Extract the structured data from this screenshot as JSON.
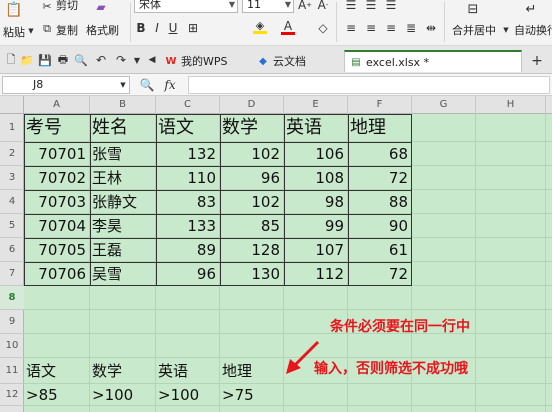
{
  "ribbon": {
    "cut_label": "剪切",
    "paste_label": "粘贴",
    "copy_label": "复制",
    "format_painter_label": "格式刷",
    "font_name": "宋体",
    "font_size": "11",
    "merge_center_label": "合并居中",
    "auto_wrap_label": "自动换行"
  },
  "tabs": [
    {
      "label": "我的WPS"
    },
    {
      "label": "云文档"
    },
    {
      "label": "excel.xlsx *"
    }
  ],
  "formula_bar": {
    "cell_ref": "J8",
    "fx_label": "fx",
    "content": ""
  },
  "columns": [
    "A",
    "B",
    "C",
    "D",
    "E",
    "F",
    "G",
    "H"
  ],
  "rows": [
    "1",
    "2",
    "3",
    "4",
    "5",
    "6",
    "7",
    "8",
    "9",
    "10",
    "11",
    "12"
  ],
  "selected_row": "8",
  "table": {
    "headers": [
      "考号",
      "姓名",
      "语文",
      "数学",
      "英语",
      "地理"
    ],
    "data": [
      [
        "70701",
        "张雪",
        "132",
        "102",
        "106",
        "68"
      ],
      [
        "70702",
        "王林",
        "110",
        "96",
        "108",
        "72"
      ],
      [
        "70703",
        "张静文",
        "83",
        "102",
        "98",
        "88"
      ],
      [
        "70704",
        "李昊",
        "133",
        "85",
        "99",
        "90"
      ],
      [
        "70705",
        "王磊",
        "89",
        "128",
        "107",
        "61"
      ],
      [
        "70706",
        "吴雪",
        "96",
        "130",
        "112",
        "72"
      ]
    ]
  },
  "criteria": {
    "headers": [
      "语文",
      "数学",
      "英语",
      "地理"
    ],
    "values": [
      ">85",
      ">100",
      ">100",
      ">75"
    ]
  },
  "annotation": {
    "line1": "条件必须要在同一行中",
    "line2": "输入，否则筛选不成功哦"
  },
  "colors": {
    "sheet_bg": "#c9e9cc",
    "annotation": "#e8151c",
    "accent": "#2e7d32"
  }
}
